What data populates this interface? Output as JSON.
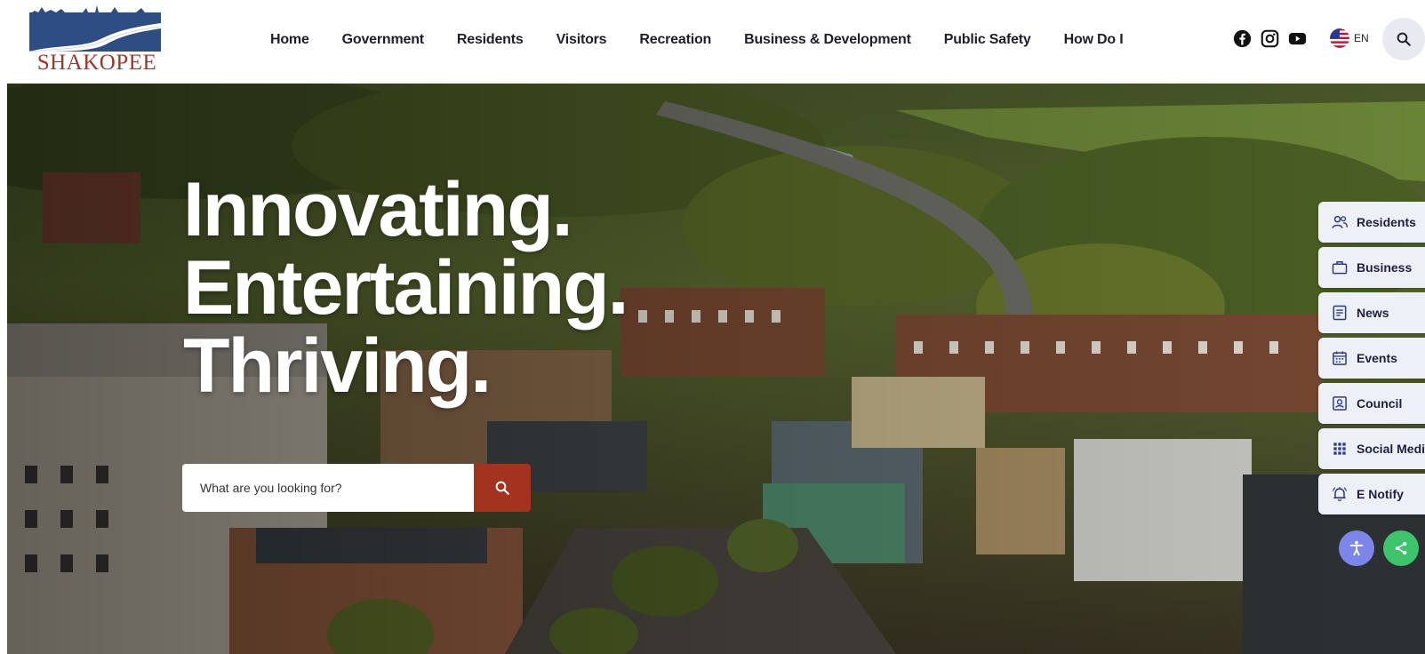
{
  "site": {
    "logo_text": "SHAKOPEE",
    "brand_colors": {
      "navy": "#2c4a7c",
      "red": "#a0362a",
      "search_red": "#a3321f"
    }
  },
  "nav": {
    "items": [
      {
        "label": "Home"
      },
      {
        "label": "Government"
      },
      {
        "label": "Residents"
      },
      {
        "label": "Visitors"
      },
      {
        "label": "Recreation"
      },
      {
        "label": "Business & Development"
      },
      {
        "label": "Public Safety"
      },
      {
        "label": "How Do I"
      }
    ]
  },
  "social": {
    "icons": [
      "facebook-icon",
      "instagram-icon",
      "youtube-icon"
    ]
  },
  "language": {
    "code": "EN",
    "icon": "us-flag-icon"
  },
  "header_search": {
    "icon": "search-icon"
  },
  "hero": {
    "headline": [
      "Innovating.",
      "Entertaining.",
      "Thriving."
    ],
    "search": {
      "placeholder": "What are you looking for?",
      "button_icon": "search-icon"
    }
  },
  "quick_links": [
    {
      "label": "Residents",
      "icon": "people-icon"
    },
    {
      "label": "Business",
      "icon": "briefcase-icon"
    },
    {
      "label": "News",
      "icon": "document-icon"
    },
    {
      "label": "Events",
      "icon": "calendar-icon"
    },
    {
      "label": "Council",
      "icon": "council-icon"
    },
    {
      "label": "Social Media",
      "icon": "grid-icon"
    },
    {
      "label": "E Notify",
      "icon": "bell-icon"
    }
  ],
  "floating_buttons": [
    {
      "name": "accessibility",
      "icon": "accessibility-icon",
      "color": "#7b86e8"
    },
    {
      "name": "share",
      "icon": "share-icon",
      "color": "#3ec46d"
    }
  ]
}
